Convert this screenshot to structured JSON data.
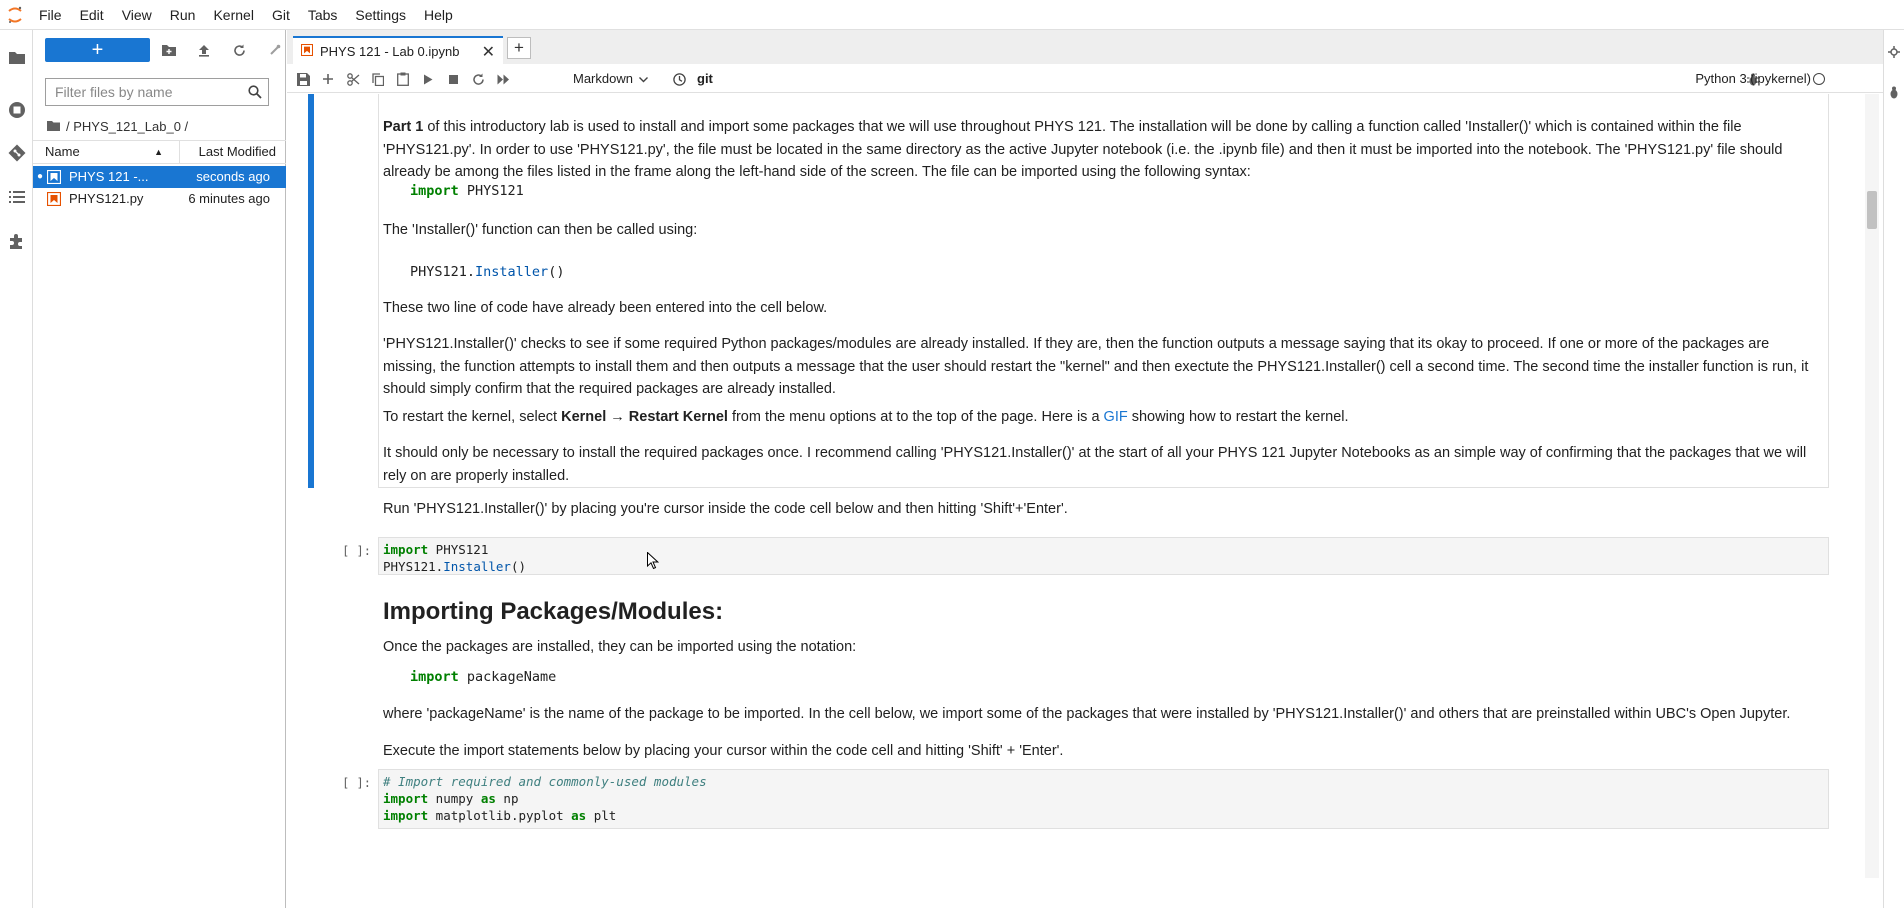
{
  "menubar": {
    "items": [
      "File",
      "Edit",
      "View",
      "Run",
      "Kernel",
      "Git",
      "Tabs",
      "Settings",
      "Help"
    ]
  },
  "filebrowser": {
    "new_label": "+",
    "search_placeholder": "Filter files by name",
    "breadcrumb": "/ PHYS_121_Lab_0 /",
    "col_name": "Name",
    "col_modified": "Last Modified",
    "files": [
      {
        "name": "PHYS 121 -...",
        "modified": "seconds ago",
        "selected": true
      },
      {
        "name": "PHYS121.py",
        "modified": "6 minutes ago",
        "selected": false
      }
    ]
  },
  "tabs": [
    {
      "label": "PHYS 121 - Lab 0.ipynb"
    }
  ],
  "toolbar": {
    "cell_type": "Markdown",
    "git_label": "git",
    "kernel_name": "Python 3 (ipykernel)"
  },
  "notebook": {
    "part1_bold": "Part 1",
    "part1_text": " of this introductory lab is used to install and import some packages that we will use throughout PHYS 121. The installation will be done by calling a function called 'Installer()' which is contained within the file 'PHYS121.py'. In order to use 'PHYS121.py', the file must be located in the same directory as the active Jupyter notebook (i.e. the .ipynb file) and then it must be imported into the notebook. The 'PHYS121.py' file should already be among the files listed in the frame along the left-hand side of the screen. The file can be imported using the following syntax:",
    "code1_kw": "import",
    "code1_rest": " PHYS121",
    "installer_intro": "The 'Installer()' function can then be called using:",
    "code2_obj": "PHYS121.",
    "code2_attr": "Installer",
    "code2_paren": "()",
    "two_lines": "These two line of code have already been entered into the cell below.",
    "checks_text": "'PHYS121.Installer()' checks to see if some required Python packages/modules are already installed. If they are, then the function outputs a message saying that its okay to proceed. If one or more of the packages are missing, the function attempts to install them and then outputs a message that the user should restart the \"kernel\" and then exectute the PHYS121.Installer() cell a second time. The second time the installer function is run, it should simply confirm that the required packages are already installed.",
    "restart_pre": "To restart the kernel, select ",
    "restart_bold": "Kernel → Restart Kernel",
    "restart_mid": " from the menu options at to the top of the page. Here is a ",
    "restart_link": "GIF",
    "restart_post": " showing how to restart the kernel.",
    "once_text": "It should only be necessary to install the required packages once. I recommend calling 'PHYS121.Installer()' at the start of all your PHYS 121 Jupyter Notebooks as an simple way of confirming that the packages that we will rely on are properly installed.",
    "run_text": "Run 'PHYS121.Installer()' by placing you're cursor inside the code cell below and then hitting 'Shift'+'Enter'.",
    "prompt": "[ ]:",
    "cell1_l1_kw": "import",
    "cell1_l1_rest": " PHYS121",
    "cell1_l2_obj": "PHYS121.",
    "cell1_l2_attr": "Installer",
    "cell1_l2_paren": "()",
    "heading": "Importing Packages/Modules:",
    "once_installed": "Once the packages are installed, they can be imported using the notation:",
    "code3_kw": "import",
    "code3_rest": " packageName",
    "where_text": "where 'packageName' is the name of the package to be imported. In the cell below, we import some of the packages that were installed by 'PHYS121.Installer()' and others that are preinstalled within UBC's Open Jupyter.",
    "execute_text": "Execute the import statements below by placing your cursor within the code cell and hitting 'Shift' + 'Enter'.",
    "cell2_comment": "# Import required and commonly-used modules",
    "cell2_l2_kw": "import",
    "cell2_l2_mid": " numpy ",
    "cell2_l2_as": "as",
    "cell2_l2_end": " np",
    "cell2_l3_kw": "import",
    "cell2_l3_mid": " matplotlib.pyplot ",
    "cell2_l3_as": "as",
    "cell2_l3_end": " plt"
  }
}
